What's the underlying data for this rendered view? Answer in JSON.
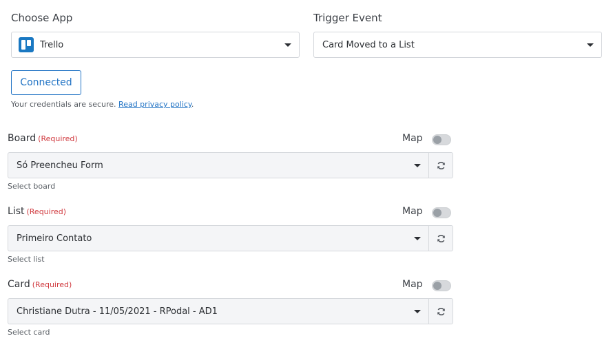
{
  "choose_app": {
    "label": "Choose App",
    "selected": "Trello",
    "app_icon": "trello-icon"
  },
  "trigger_event": {
    "label": "Trigger Event",
    "selected": "Card Moved to a List"
  },
  "connection": {
    "button_label": "Connected",
    "credentials_text": "Your credentials are secure.",
    "privacy_link": "Read privacy policy",
    "trailing_period": "."
  },
  "fields": [
    {
      "label": "Board",
      "required": "(Required)",
      "map_label": "Map",
      "value": "Só Preencheu Form",
      "hint": "Select board"
    },
    {
      "label": "List",
      "required": "(Required)",
      "map_label": "Map",
      "value": "Primeiro Contato",
      "hint": "Select list"
    },
    {
      "label": "Card",
      "required": "(Required)",
      "map_label": "Map",
      "value": "Christiane Dutra - 11/05/2021 - RPodal - AD1",
      "hint": "Select card"
    }
  ],
  "colors": {
    "accent": "#1f72c4",
    "required": "#d0393e",
    "trello_blue": "#1a78c2"
  }
}
